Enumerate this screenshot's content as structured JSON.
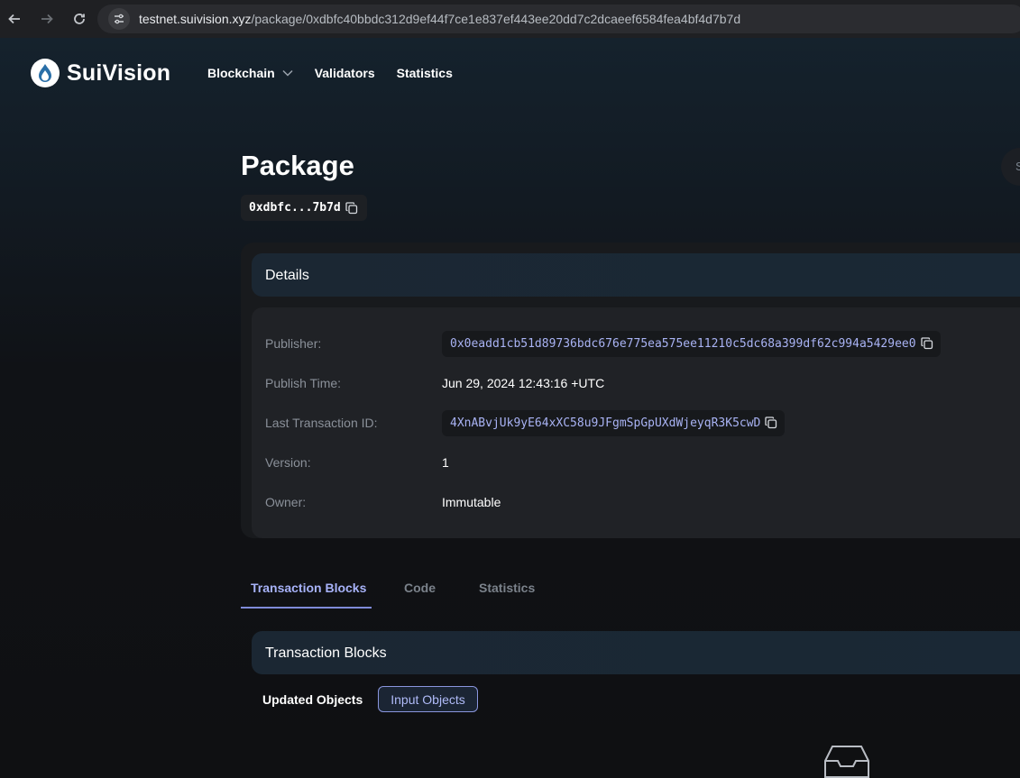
{
  "browser": {
    "url_host": "testnet.suivision.xyz",
    "url_path": "/package/0xdbfc40bbdc312d9ef44f7ce1e837ef443ee20dd7c2dcaeef6584fea4bf4d7b7d",
    "icons": [
      "back-arrow-icon",
      "forward-arrow-icon",
      "reload-icon",
      "site-settings-icon"
    ]
  },
  "header": {
    "logo_text": "SuiVision",
    "menu": [
      {
        "label": "Blockchain",
        "has_dropdown": true
      },
      {
        "label": "Validators"
      },
      {
        "label": "Statistics"
      }
    ],
    "search_fragment": "S"
  },
  "page": {
    "title": "Package",
    "package_id_short": "0xdbfc...7b7d"
  },
  "details": {
    "heading": "Details",
    "rows": [
      {
        "label": "Publisher:",
        "value": "0x0eadd1cb51d89736bdc676e775ea575ee11210c5dc68a399df62c994a5429ee0"
      },
      {
        "label": "Publish Time:",
        "value": "Jun 29, 2024 12:43:16 +UTC"
      },
      {
        "label": "Last Transaction ID:",
        "value": "4XnABvjUk9yE64xXC58u9JFgmSpGpUXdWjeyqR3K5cwD"
      },
      {
        "label": "Version:",
        "value": "1"
      },
      {
        "label": "Owner:",
        "value": "Immutable"
      }
    ]
  },
  "tabs": [
    {
      "label": "Transaction Blocks",
      "active": true
    },
    {
      "label": "Code",
      "active": false
    },
    {
      "label": "Statistics",
      "active": false
    }
  ],
  "transaction_blocks": {
    "heading": "Transaction Blocks",
    "filters": [
      {
        "label": "Updated Objects",
        "active": false
      },
      {
        "label": "Input Objects",
        "active": true
      }
    ]
  },
  "colors": {
    "accent": "#a7b2f8",
    "background": "#0f1012",
    "card": "#202226"
  }
}
